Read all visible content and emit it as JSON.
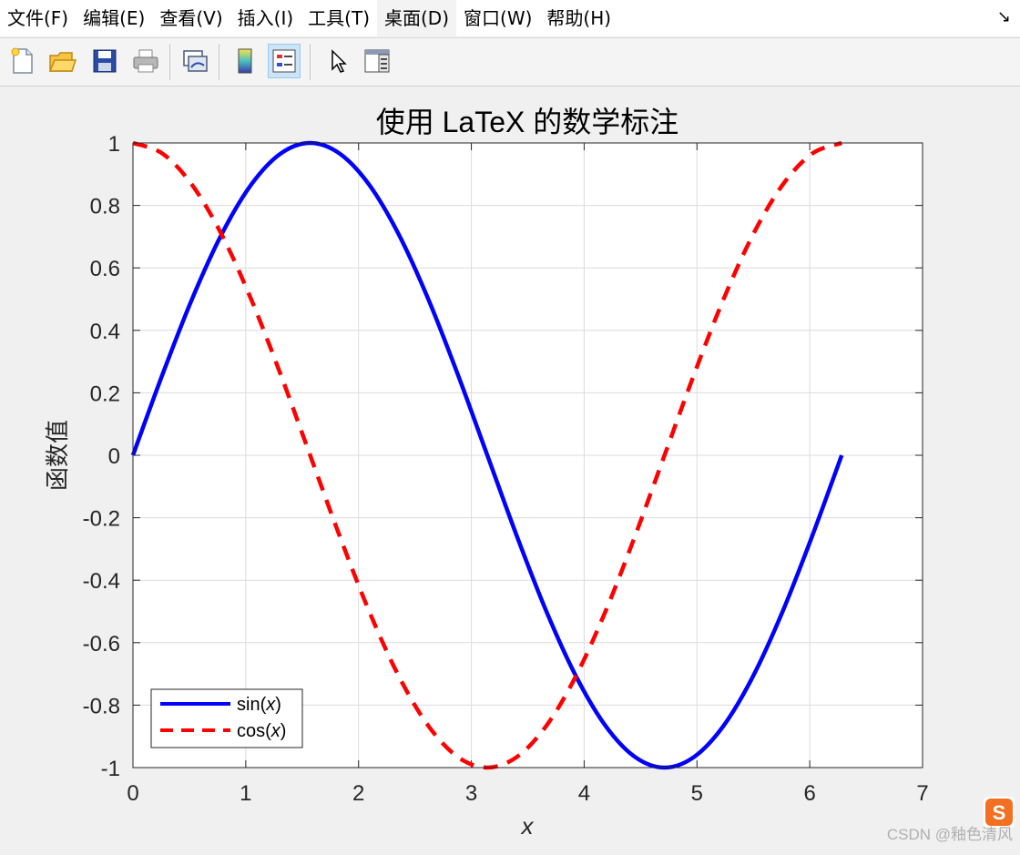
{
  "menu": {
    "items": [
      "文件(F)",
      "编辑(E)",
      "查看(V)",
      "插入(I)",
      "工具(T)",
      "桌面(D)",
      "窗口(W)",
      "帮助(H)"
    ],
    "active_index": 5
  },
  "toolbar": {
    "buttons": [
      "new-figure",
      "open-file",
      "save",
      "print",
      "link-plot",
      "colorbar",
      "legend",
      "pointer",
      "property-editor"
    ],
    "active": "legend"
  },
  "colors": {
    "sin": "#0000ff",
    "cos": "#ff0000",
    "grid": "#dcdcdc",
    "axes_bg": "#ffffff",
    "figure_bg": "#f0f0f0"
  },
  "chart_data": {
    "type": "line",
    "title": "使用 LaTeX 的数学标注",
    "xlabel": "x",
    "ylabel": "函数值",
    "xlim": [
      0,
      7
    ],
    "ylim": [
      -1,
      1
    ],
    "xticks": [
      "0",
      "1",
      "2",
      "3",
      "4",
      "5",
      "6",
      "7"
    ],
    "yticks": [
      "1",
      "0.8",
      "0.6",
      "0.4",
      "0.2",
      "0",
      "-0.2",
      "-0.4",
      "-0.6",
      "-0.8",
      "-1"
    ],
    "grid": true,
    "legend_position": "bottom-left",
    "series": [
      {
        "name": "sin(x)",
        "style": "solid",
        "color": "#0000ff",
        "x": [
          0,
          0.2618,
          0.5236,
          0.7854,
          1.0472,
          1.309,
          1.5708,
          1.8326,
          2.0944,
          2.3562,
          2.618,
          2.8798,
          3.1416,
          3.4034,
          3.6652,
          3.927,
          4.1888,
          4.4506,
          4.7124,
          4.9742,
          5.236,
          5.4978,
          5.7596,
          6.0214,
          6.2832
        ],
        "y": [
          0,
          0.2588,
          0.5,
          0.7071,
          0.866,
          0.9659,
          1,
          0.9659,
          0.866,
          0.7071,
          0.5,
          0.2588,
          0,
          -0.2588,
          -0.5,
          -0.7071,
          -0.866,
          -0.9659,
          -1,
          -0.9659,
          -0.866,
          -0.7071,
          -0.5,
          -0.2588,
          0
        ]
      },
      {
        "name": "cos(x)",
        "style": "dashed",
        "color": "#ff0000",
        "x": [
          0,
          0.2618,
          0.5236,
          0.7854,
          1.0472,
          1.309,
          1.5708,
          1.8326,
          2.0944,
          2.3562,
          2.618,
          2.8798,
          3.1416,
          3.4034,
          3.6652,
          3.927,
          4.1888,
          4.4506,
          4.7124,
          4.9742,
          5.236,
          5.4978,
          5.7596,
          6.0214,
          6.2832
        ],
        "y": [
          1,
          0.9659,
          0.866,
          0.7071,
          0.5,
          0.2588,
          0,
          -0.2588,
          -0.5,
          -0.7071,
          -0.866,
          -0.9659,
          -1,
          -0.9659,
          -0.866,
          -0.7071,
          -0.5,
          -0.2588,
          0,
          0.2588,
          0.5,
          0.7071,
          0.866,
          0.9659,
          1
        ]
      }
    ],
    "legend": {
      "entries": [
        {
          "fn": "sin",
          "var": "x"
        },
        {
          "fn": "cos",
          "var": "x"
        }
      ]
    }
  },
  "watermark": "CSDN @釉色清风"
}
